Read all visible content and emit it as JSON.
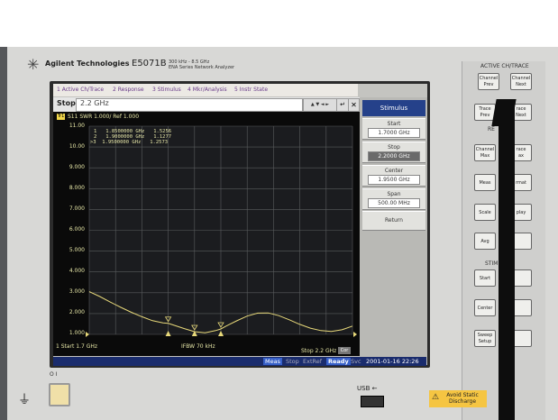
{
  "instrument": {
    "brand": "Agilent Technologies",
    "model": "E5071B",
    "model_sub_line1": "300 kHz - 8.5 GHz",
    "model_sub_line2": "ENA Series  Network Analyzer",
    "logo_icon": "agilent-spark-icon"
  },
  "menubar": {
    "items": [
      "1 Active Ch/Trace",
      "2 Response",
      "3 Stimulus",
      "4 Mkr/Analysis",
      "5 Instr State"
    ]
  },
  "entry": {
    "label": "Stop",
    "value": "2.2 GHz",
    "enter_glyph": "↵",
    "close_glyph": "✕",
    "spin_glyphs": "▲ ▼ ◄ ►"
  },
  "softkeys": {
    "title": "Stimulus",
    "items": [
      {
        "label": "Start",
        "value": "1.7000 GHz"
      },
      {
        "label": "Stop",
        "value": "2.2000 GHz",
        "selected": true
      },
      {
        "label": "Center",
        "value": "1.9500 GHz"
      },
      {
        "label": "Span",
        "value": "500.00 MHz"
      }
    ],
    "return_label": "Return"
  },
  "trace": {
    "channel_tag": "Tr1",
    "header": "S11  SWR 1.000/ Ref 1.000",
    "markers": [
      {
        "line": "1   1.8500000 GHz   1.5256"
      },
      {
        "line": "2   1.9000000 GHz   1.1277"
      },
      {
        "line": ">3  1.9500000 GHz   1.2573"
      }
    ],
    "color": "#e8d97a"
  },
  "chart_data": {
    "type": "line",
    "title": "",
    "xlabel": "",
    "ylabel": "",
    "xlim": [
      1.7,
      2.2
    ],
    "ylim": [
      1.0,
      11.0
    ],
    "y_ticks": [
      "11.00",
      "10.00",
      "9.000",
      "8.000",
      "7.000",
      "6.000",
      "5.000",
      "4.000",
      "3.000",
      "2.000",
      "1.000"
    ],
    "series": [
      {
        "x": [
          1.7,
          1.72,
          1.74,
          1.76,
          1.78,
          1.8,
          1.82,
          1.84,
          1.85,
          1.86,
          1.88,
          1.9,
          1.92,
          1.94,
          1.95,
          1.96,
          1.98,
          2.0,
          2.02,
          2.04,
          2.06,
          2.08,
          2.1,
          2.12,
          2.14,
          2.16,
          2.18,
          2.2
        ],
        "y": [
          3.05,
          2.82,
          2.55,
          2.3,
          2.06,
          1.85,
          1.66,
          1.55,
          1.53,
          1.45,
          1.28,
          1.13,
          1.08,
          1.18,
          1.26,
          1.4,
          1.65,
          1.88,
          2.02,
          2.03,
          1.9,
          1.7,
          1.48,
          1.3,
          1.18,
          1.14,
          1.22,
          1.4
        ]
      }
    ],
    "markers_x": [
      1.85,
      1.9,
      1.95
    ],
    "grid": true
  },
  "footer": {
    "start": "1  Start 1.7 GHz",
    "ifbw": "IFBW 70 kHz",
    "stop": "Stop 2.2 GHz",
    "cal": "Cor"
  },
  "status": {
    "meas": "Meas",
    "stop": "Stop",
    "extref": "ExtRef",
    "ready": "Ready",
    "svc": "Svc",
    "datetime": "2001-01-16 22:26"
  },
  "panel": {
    "active_title": "ACTIVE CH/TRACE",
    "response_title": "RE",
    "stimulus_title": "STIM",
    "keys": {
      "channel_prev": [
        "Channel",
        "Prev"
      ],
      "channel_next": [
        "Channel",
        "Next"
      ],
      "trace_prev": [
        "Trace",
        "Prev"
      ],
      "trace_next": [
        "race",
        "Next"
      ],
      "channel_max": [
        "Channel",
        "Max"
      ],
      "trace_max": [
        "race",
        "ax"
      ],
      "meas": [
        "Meas"
      ],
      "format": [
        "rmat"
      ],
      "scale": [
        "Scale"
      ],
      "display": [
        "play"
      ],
      "avg": [
        "Avg"
      ],
      "cal": [
        ""
      ],
      "start": [
        "Start"
      ],
      "stop": [
        ""
      ],
      "center": [
        "Center"
      ],
      "span": [
        ""
      ],
      "sweep_setup": [
        "Sweep",
        "Setup"
      ],
      "sweep_type": [
        ""
      ]
    }
  },
  "bottom": {
    "power_symbols": "O  I",
    "usb_label": "USB ←",
    "warning_line1": "Avoid Static",
    "warning_line2": "Discharge"
  }
}
